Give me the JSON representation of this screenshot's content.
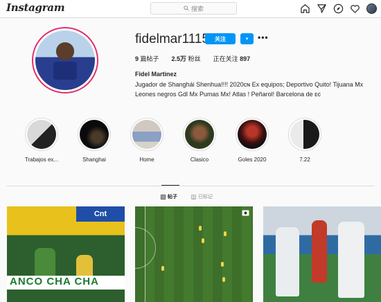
{
  "nav": {
    "logo": "Instagram",
    "search_placeholder": "搜索",
    "icons": [
      "home-icon",
      "direct-icon",
      "explore-icon",
      "activity-icon",
      "avatar"
    ]
  },
  "profile": {
    "username": "fidelmar1115",
    "follow_label": "关注",
    "dropdown_label": "▾",
    "more_label": "•••",
    "stats": {
      "posts_count": "9",
      "posts_label": "篇帖子",
      "followers_count": "2.5万",
      "followers_label": "粉丝",
      "following_label": "正在关注",
      "following_count": "897"
    },
    "full_name": "Fidel Martinez",
    "bio": "Jugador de Shanghái Shenhua!!!! 2020ᴄɴ Ex equipos; Deportivo Quito! Tijuana Mx Leones negros Gdl Mx Pumas Mx! Atlas ! Peñarol! Barcelona de ᴇᴄ"
  },
  "highlights": [
    {
      "label": "Trabajos ex..."
    },
    {
      "label": "Shanghai"
    },
    {
      "label": "Home"
    },
    {
      "label": "Clasico"
    },
    {
      "label": "Goles 2020"
    },
    {
      "label": "7.22"
    }
  ],
  "tabs": {
    "posts_label": "帖子",
    "tagged_label": "已标记"
  },
  "posts": {
    "post1_banner": "ANCO  CHA  CHA",
    "post1_ad": "Cnt"
  },
  "colors": {
    "accent": "#0095f6",
    "text": "#262626",
    "muted": "#8e8e8e",
    "border": "#dbdbdb"
  }
}
